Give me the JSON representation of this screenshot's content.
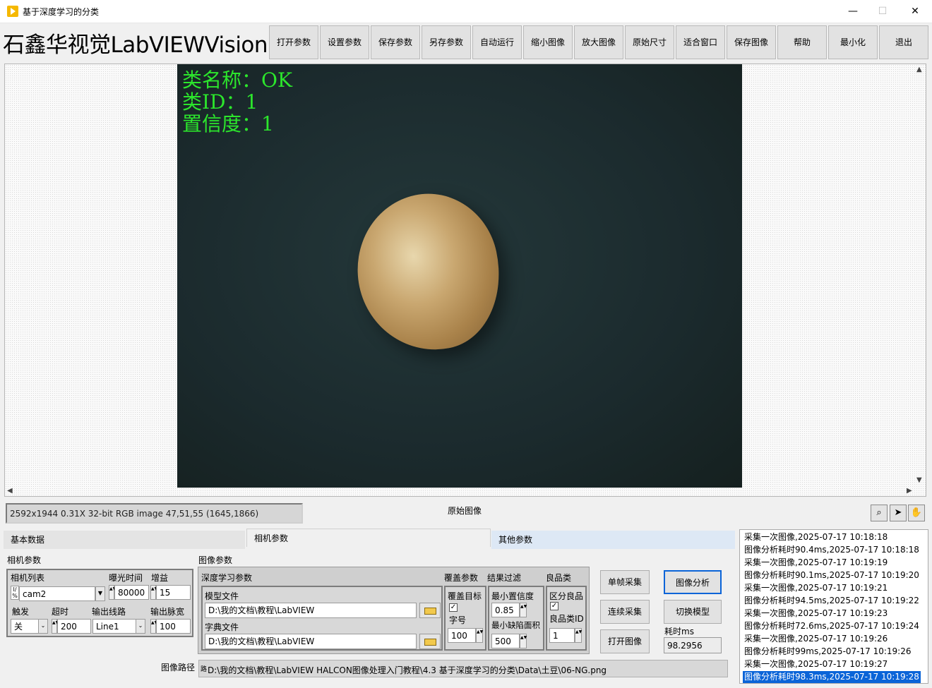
{
  "window": {
    "title": "基于深度学习的分类",
    "minimize": "—",
    "maximize": "☐",
    "close": "✕"
  },
  "brand": "石鑫华视觉LabVIEWVision",
  "toolbar": [
    "打开参数",
    "设置参数",
    "保存参数",
    "另存参数",
    "自动运行",
    "缩小图像",
    "放大图像",
    "原始尺寸",
    "适合窗口",
    "保存图像",
    "帮助",
    "最小化",
    "退出"
  ],
  "overlay": {
    "line1": "类名称：OK",
    "line2": "类ID：1",
    "line3": "置信度：1"
  },
  "viewer": {
    "info": "2592x1944 0.31X 32-bit RGB image 47,51,55    (1645,1866)",
    "caption": "原始图像"
  },
  "tabs": [
    "基本数据",
    "相机参数",
    "其他参数"
  ],
  "camera": {
    "section": "相机参数",
    "list_label": "相机列表",
    "list_value": "cam2",
    "exposure_label": "曝光时间",
    "exposure_value": "80000",
    "gain_label": "增益",
    "gain_value": "15",
    "trigger_label": "触发",
    "trigger_value": "关",
    "timeout_label": "超时",
    "timeout_value": "200",
    "line_label": "输出线路",
    "line_value": "Line1",
    "pulse_label": "输出脉宽",
    "pulse_value": "100"
  },
  "image_params": {
    "section": "图像参数",
    "dl_label": "深度学习参数",
    "model_label": "模型文件",
    "model_value": "D:\\我的文档\\教程\\LabVIEW",
    "dict_label": "字典文件",
    "dict_value": "D:\\我的文档\\教程\\LabVIEW",
    "overlay_label": "覆盖参数",
    "overlay_target_label": "覆盖目标",
    "overlay_target_checked": "✓",
    "font_size_label": "字号",
    "font_size_value": "100",
    "filter_label": "结果过滤",
    "min_conf_label": "最小置信度",
    "min_conf_value": "0.85",
    "min_area_label": "最小缺陷面积",
    "min_area_value": "500",
    "good_label": "良品类",
    "distinguish_label": "区分良品",
    "distinguish_checked": "✓",
    "good_id_label": "良品类ID",
    "good_id_value": "1"
  },
  "actions": {
    "single": "单帧采集",
    "continuous": "连续采集",
    "open_image": "打开图像",
    "analyze": "图像分析",
    "switch_model": "切换模型",
    "time_label": "耗时ms",
    "time_value": "98.2956"
  },
  "path": {
    "label": "图像路径",
    "prefix": "路",
    "value": "D:\\我的文档\\教程\\LabVIEW HALCON图像处理入门教程\\4.3 基于深度学习的分类\\Data\\土豆\\06-NG.png"
  },
  "log": [
    "采集一次图像,2025-07-17 10:18:18",
    "图像分析耗时90.4ms,2025-07-17 10:18:18",
    "采集一次图像,2025-07-17 10:19:19",
    "图像分析耗时90.1ms,2025-07-17 10:19:20",
    "采集一次图像,2025-07-17 10:19:21",
    "图像分析耗时94.5ms,2025-07-17 10:19:22",
    "采集一次图像,2025-07-17 10:19:23",
    "图像分析耗时72.6ms,2025-07-17 10:19:24",
    "采集一次图像,2025-07-17 10:19:26",
    "图像分析耗时99ms,2025-07-17 10:19:26",
    "采集一次图像,2025-07-17 10:19:27",
    "图像分析耗时98.3ms,2025-07-17 10:19:28"
  ]
}
